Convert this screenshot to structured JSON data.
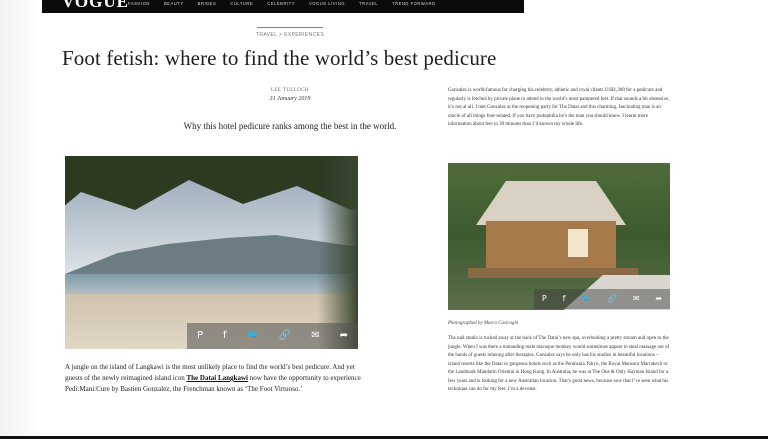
{
  "header": {
    "logo": "VOGUE",
    "nav_items": [
      "Fashion",
      "Beauty",
      "Brides",
      "Culture",
      "Celebrity",
      "Vogue Living",
      "Travel",
      "Trend Forward"
    ]
  },
  "article": {
    "breadcrumb": "Travel > Experiences",
    "title": "Foot fetish: where to find the world’s best pedicure",
    "author": "Lee Tulloch",
    "date": "31 January 2019",
    "standfirst": "Why this hotel pedicure ranks among the best in the world.",
    "share_icons": {
      "pinterest": "P",
      "facebook": "f",
      "twitter": "🐦",
      "link": "🔗",
      "email": "✉",
      "share": "➦"
    },
    "left_intro_before": "A jungle on the island of Langkawi is the most unlikely place to find the world’s best pedicure. And yet guests of the newly reimagined island icon ",
    "left_intro_link": "The Datai Langkawi",
    "left_intro_after": " now have the opportunity to experience Pedi:Mani:Cure by Bastien Gonzalez, the Frenchman known as ‘The Foot Virtuoso.’",
    "right_top": "Gonzalez is world-famous for charging his celebrity, athletic and royal clients US$1,300 for a pedicure and regularly is fetched by private plane to attend to the world’s most pampered feet. If that sounds a bit obsessive, it’s not at all. I met Gonzalez at the reopening party for The Datai and this charming, fascinating man is an oracle of all things foot-related. If you have podophilia he’s the man you should know. I learnt more information about feet in 30 minutes than I’d known my whole life.",
    "photo_credit": "Photographed by Marco Casiraghi",
    "right_bottom": "The nail studio is tucked away at the back of The Datai’s new spa, overlooking a pretty stream and open to the jungle. When I was there a marauding male macaque monkey would sometimes appear to steal massage out of the hands of guests relaxing after therapies. Gonzalez says he only has his studios in beautiful locations – island resorts like the Datai or gorgeous hotels such as the Peninsula Tokyo, the Royal Mansour Marrakech or the Landmark Mandarin Oriental in Hong Kong. In Australia, he was at The One & Only Hayman Island for a few years and is looking for a new Australian location. That’s good news, because now that I’ve seen what his technique can do for my feet, I’m a devotee."
  }
}
